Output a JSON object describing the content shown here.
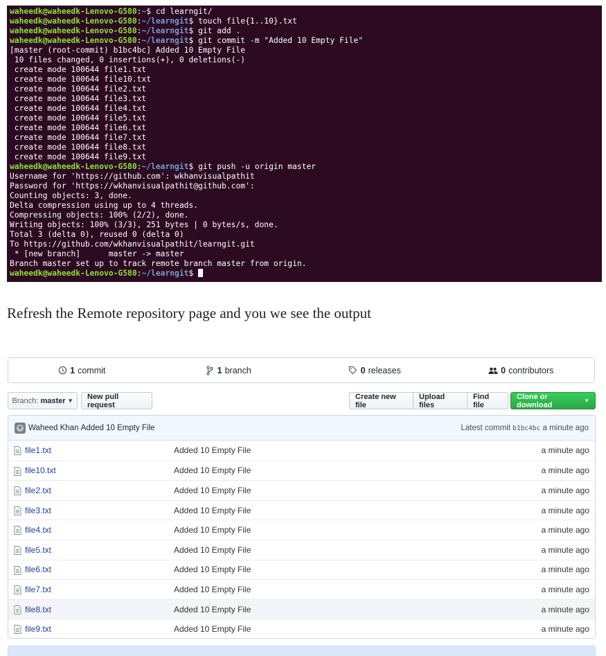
{
  "terminal": {
    "prompt_user": "waheedk@waheedk-Lenovo-G580",
    "lines": [
      {
        "type": "prompt",
        "path": "~",
        "cmd": "cd learngit/"
      },
      {
        "type": "prompt",
        "path": "~/learngit",
        "cmd": "touch file{1..10}.txt"
      },
      {
        "type": "prompt",
        "path": "~/learngit",
        "cmd": "git add ."
      },
      {
        "type": "prompt",
        "path": "~/learngit",
        "cmd": "git commit -m \"Added 10 Empty File\""
      },
      {
        "type": "out",
        "text": "[master (root-commit) b1bc4bc] Added 10 Empty File"
      },
      {
        "type": "out",
        "text": " 10 files changed, 0 insertions(+), 0 deletions(-)"
      },
      {
        "type": "out",
        "text": " create mode 100644 file1.txt"
      },
      {
        "type": "out",
        "text": " create mode 100644 file10.txt"
      },
      {
        "type": "out",
        "text": " create mode 100644 file2.txt"
      },
      {
        "type": "out",
        "text": " create mode 100644 file3.txt"
      },
      {
        "type": "out",
        "text": " create mode 100644 file4.txt"
      },
      {
        "type": "out",
        "text": " create mode 100644 file5.txt"
      },
      {
        "type": "out",
        "text": " create mode 100644 file6.txt"
      },
      {
        "type": "out",
        "text": " create mode 100644 file7.txt"
      },
      {
        "type": "out",
        "text": " create mode 100644 file8.txt"
      },
      {
        "type": "out",
        "text": " create mode 100644 file9.txt"
      },
      {
        "type": "prompt",
        "path": "~/learngit",
        "cmd": "git push -u origin master"
      },
      {
        "type": "out",
        "text": "Username for 'https://github.com': wkhanvisualpathit"
      },
      {
        "type": "out",
        "text": "Password for 'https://wkhanvisualpathit@github.com':"
      },
      {
        "type": "out",
        "text": "Counting objects: 3, done."
      },
      {
        "type": "out",
        "text": "Delta compression using up to 4 threads."
      },
      {
        "type": "out",
        "text": "Compressing objects: 100% (2/2), done."
      },
      {
        "type": "out",
        "text": "Writing objects: 100% (3/3), 251 bytes | 0 bytes/s, done."
      },
      {
        "type": "out",
        "text": "Total 3 (delta 0), reused 0 (delta 0)"
      },
      {
        "type": "out",
        "text": "To https://github.com/wkhanvisualpathit/learngit.git"
      },
      {
        "type": "out",
        "text": " * [new branch]      master -> master"
      },
      {
        "type": "out",
        "text": "Branch master set up to track remote branch master from origin."
      },
      {
        "type": "prompt",
        "path": "~/learngit",
        "cmd": "",
        "cursor": true
      }
    ]
  },
  "caption": "Refresh the Remote repository page and you we see the output",
  "summary": {
    "commits": {
      "count": "1",
      "label": "commit",
      "icon": "history-icon"
    },
    "branches": {
      "count": "1",
      "label": "branch",
      "icon": "branch-icon"
    },
    "releases": {
      "count": "0",
      "label": "releases",
      "icon": "tag-icon"
    },
    "contributors": {
      "count": "0",
      "label": "contributors",
      "icon": "people-icon"
    }
  },
  "toolbar": {
    "branch_prefix": "Branch:",
    "branch_name": "master",
    "new_pull_request": "New pull request",
    "create_new_file": "Create new file",
    "upload_files": "Upload files",
    "find_file": "Find file",
    "clone_or_download": "Clone or download"
  },
  "latest_commit": {
    "author": "Waheed Khan",
    "message": "Added 10 Empty File",
    "label": "Latest commit",
    "sha": "b1bc4bc",
    "age": "a minute ago"
  },
  "files": [
    {
      "name": "file1.txt",
      "message": "Added 10 Empty File",
      "age": "a minute ago"
    },
    {
      "name": "file10.txt",
      "message": "Added 10 Empty File",
      "age": "a minute ago"
    },
    {
      "name": "file2.txt",
      "message": "Added 10 Empty File",
      "age": "a minute ago"
    },
    {
      "name": "file3.txt",
      "message": "Added 10 Empty File",
      "age": "a minute ago"
    },
    {
      "name": "file4.txt",
      "message": "Added 10 Empty File",
      "age": "a minute ago"
    },
    {
      "name": "file5.txt",
      "message": "Added 10 Empty File",
      "age": "a minute ago"
    },
    {
      "name": "file6.txt",
      "message": "Added 10 Empty File",
      "age": "a minute ago"
    },
    {
      "name": "file7.txt",
      "message": "Added 10 Empty File",
      "age": "a minute ago"
    },
    {
      "name": "file8.txt",
      "message": "Added 10 Empty File",
      "age": "a minute ago",
      "hovered": true
    },
    {
      "name": "file9.txt",
      "message": "Added 10 Empty File",
      "age": "a minute ago"
    }
  ],
  "colors": {
    "terminal_bg": "#2c0a22",
    "prompt_user": "#8ae234",
    "prompt_path": "#729fcf",
    "link": "#1a3f9a",
    "clone_button": "#28a745",
    "commit_bar": "#f1f8ff"
  }
}
